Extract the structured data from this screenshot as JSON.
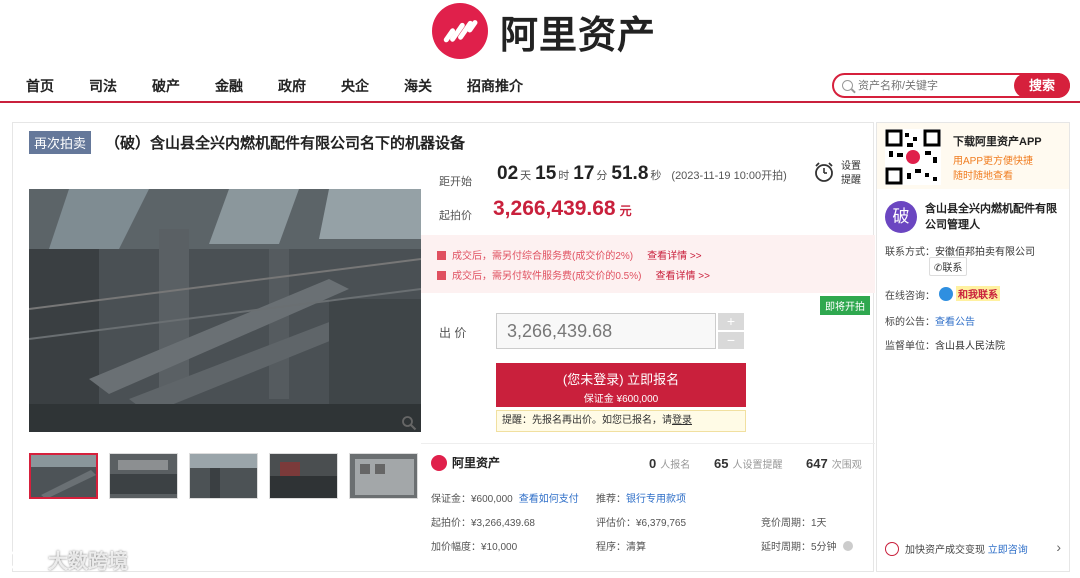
{
  "brand": {
    "name": "阿里资产",
    "color": "#e0204b"
  },
  "nav": {
    "items": [
      "首页",
      "司法",
      "破产",
      "金融",
      "政府",
      "央企",
      "海关",
      "招商推介"
    ]
  },
  "search": {
    "placeholder": "资产名称/关键字",
    "button": "搜索"
  },
  "item": {
    "tag": "再次拍卖",
    "title": "（破）含山县全兴内燃机配件有限公司名下的机器设备"
  },
  "countdown": {
    "label": "距开始",
    "days": "02",
    "days_unit": "天",
    "hours": "15",
    "hours_unit": "时",
    "minutes": "17",
    "minutes_unit": "分",
    "seconds": "51.8",
    "seconds_unit": "秒",
    "start_note": "(2023-11-19 10:00开拍)"
  },
  "remind": {
    "line1": "设置",
    "line2": "提醒"
  },
  "start_price": {
    "label": "起拍价",
    "value": "3,266,439.68",
    "unit": "元"
  },
  "fees": [
    {
      "text": "成交后，需另付综合服务费(成交价的2%)",
      "link": "查看详情 >>"
    },
    {
      "text": "成交后，需另付软件服务费(成交价的0.5%)",
      "link": "查看详情 >>"
    }
  ],
  "status_tag": "即将开拍",
  "bid": {
    "label": "出  价",
    "value": "3,266,439.68",
    "plus": "+",
    "minus": "−"
  },
  "signup": {
    "main": "(您未登录) 立即报名",
    "sub": "保证金 ¥600,000"
  },
  "notice": {
    "text": "提醒：先报名再出价。如您已报名，请",
    "link": "登录"
  },
  "stats": {
    "signups": "0",
    "signups_label": "人报名",
    "reminders": "65",
    "reminders_label": "人设置提醒",
    "views": "647",
    "views_label": "次围观"
  },
  "details": {
    "deposit": "保证金：¥600,000",
    "deposit_link": "查看如何支付",
    "recommend": "推荐：",
    "recommend_link": "银行专用款项",
    "start": "起拍价：¥3,266,439.68",
    "assess": "评估价：¥6,379,765",
    "cycle": "竞价周期：1天",
    "increment": "加价幅度：¥10,000",
    "procedure": "程序：清算",
    "delay": "延时周期：5分钟"
  },
  "side": {
    "app_title": "下载阿里资产APP",
    "app_sub1": "用APP更方便快捷",
    "app_sub2": "随时随地查看",
    "avatar_char": "破",
    "manager": "含山县全兴内燃机配件有限公司管理人",
    "contact_label": "联系方式：",
    "contact_value": "安徽佰邦拍卖有限公司",
    "contact_btn": "联系",
    "consult_label": "在线咨询：",
    "consult_text": "和我联系",
    "notice_label": "标的公告：",
    "notice_link": "查看公告",
    "supervisor_label": "监督单位：",
    "supervisor_value": "含山县人民法院",
    "speed_text": "加快资产成交变现",
    "speed_link": "立即咨询",
    "speed_arrow": "›"
  },
  "watermark": "大数跨境"
}
